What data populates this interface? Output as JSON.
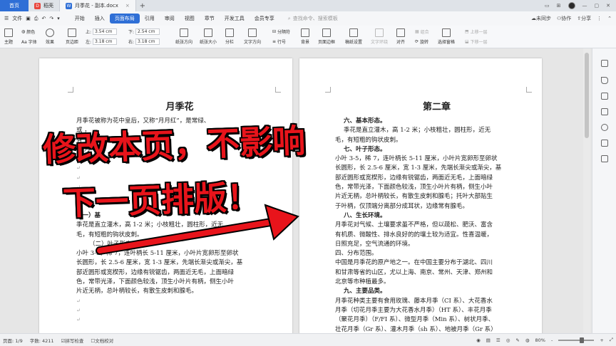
{
  "titlebar": {
    "home": "首页",
    "tabs": [
      {
        "label": "稻壳",
        "icon": "docer-logo-icon"
      },
      {
        "label": "月季花 - 副本.docx",
        "icon": "wps-writer-logo-icon"
      }
    ],
    "new_tab": "+",
    "close": "×"
  },
  "menubar": {
    "file": "文件",
    "items": [
      "开始",
      "插入",
      "页面布局",
      "引用",
      "审阅",
      "视图",
      "章节",
      "开发工具",
      "会员专享"
    ],
    "active": "页面布局",
    "search": "查找命令、搜索模板",
    "unsync": "未同步",
    "collab": "协作",
    "share": "分享"
  },
  "ribbon": {
    "theme": "主题",
    "color": "颜色",
    "font": "Aa 字体",
    "effect": "效果",
    "margins": "页边距",
    "top_label": "上:",
    "top_value": "3.54 cm",
    "bottom_label": "下:",
    "bottom_value": "2.54 cm",
    "left_label": "左:",
    "left_value": "3.18 cm",
    "right_label": "右:",
    "right_value": "3.18 cm",
    "orientation": "纸张方向",
    "size": "纸张大小",
    "columns": "分栏",
    "text_direction": "文字方向",
    "line_numbers": "行号",
    "breaks": "分隔符",
    "background": "背景",
    "page_border": "页面边框",
    "manuscript": "稿纸设置",
    "wrap": "文字环绕",
    "align": "对齐",
    "rotate": "旋转",
    "select_pane": "选择窗格",
    "group": "组合",
    "bring_forward": "上移一层",
    "send_backward": "下移一层"
  },
  "page1": {
    "title": "月季花",
    "lines": [
      "月季花被称为花中皇后，又称“月月红”，是常绿、",
      "或                                          ，",
      "有",
      "高                                            月",
      "为我国原产",
      "",
      "",
      "",
      "",
      "",
      ""
    ],
    "section1": "（一）基",
    "section1_lines": [
      "季花是直立灌木，高 1-2 米；小枝粗壮，圆柱形，近无",
      "毛，有短粗的钩状皮刺。"
    ],
    "section2": "（二）叶子形态。",
    "section2_lines": [
      "小叶 3-5，稀 7，连叶柄长 5-11 厘米，小叶片宽卵形至卵状",
      "长圆形，长 2.5-6 厘米，宽 1-3 厘米，先端长渐尖或渐尖，基",
      "部近圆形或宽楔形，边缘有锐锯齿，两面近无毛，上面暗绿",
      "色，常带光泽，下面颜色较浅，顶生小叶片有柄，侧生小叶",
      "片近无柄，总叶柄较长，有散生皮刺和腺毛。"
    ]
  },
  "page2": {
    "title": "第二章",
    "s6": "六、基本形态。",
    "s6_lines": [
      "季花是直立灌木，高 1-2 米；小枝粗壮，圆柱形，近无",
      "毛，有短粗的钩状皮刺。"
    ],
    "s7": "七、叶子形态。",
    "s7_lines": [
      "小叶 3-5，稀 7，连叶柄长 5-11 厘米，小叶片宽卵形至卵状",
      "长圆形，长 2.5-6 厘米，宽 1-3 厘米，先端长渐尖或渐尖，基",
      "部近圆形或宽楔形，边缘有锐锯齿，两面近无毛，上面暗绿",
      "色，常带光泽，下面颜色较浅，顶生小叶片有柄，侧生小叶",
      "片近无柄，总叶柄较长，有散生皮刺和腺毛；托叶大部贴生",
      "于叶柄，仅顶端分离部分成耳状，边缘常有腺毛。"
    ],
    "s8": "八、生长环境。",
    "s8_lines": [
      "月季花对气候、土壤要求虽不严格，但以疏松、肥沃、富含",
      "有机质、微酸性、排水良好的的壤土较为适宜。性喜温暖，",
      "日照充足，空气流通的环境。",
      "四、分布范围。",
      "中国是月季花的原产地之一。在中国主要分布于湖北、四川",
      "和甘肃等省的山区，尤以上海、南京、常州、天津、郑州和",
      "北京等市种植最多。"
    ],
    "s9": "九、主要品类。",
    "s9_lines": [
      "月季花种类主要有食用玫瑰、藤本月季（CI 系）、大花香水",
      "月季（切花月季主要为大花香水月季）（HT 系）、丰花月季",
      "（聚花月季）（F/FI 系）、微型月季（Min 系）、树状月季、",
      "壮花月季（Gr 系）、灌木月季（sh 系）、地被月季（Gr 系）"
    ]
  },
  "overlay": {
    "line1": "修改本页，不影响",
    "line2": "下一页排版！"
  },
  "statusbar": {
    "page": "页面: 1/9",
    "words": "字数: 4211",
    "spellcheck": "拼写检查",
    "proofread": "文档校对",
    "zoom": "80%",
    "zoom_minus": "-",
    "zoom_plus": "+"
  },
  "colors": {
    "accent": "#2f6fd6",
    "overlay_text": "#e8141b",
    "arrow": "#e8141b"
  }
}
